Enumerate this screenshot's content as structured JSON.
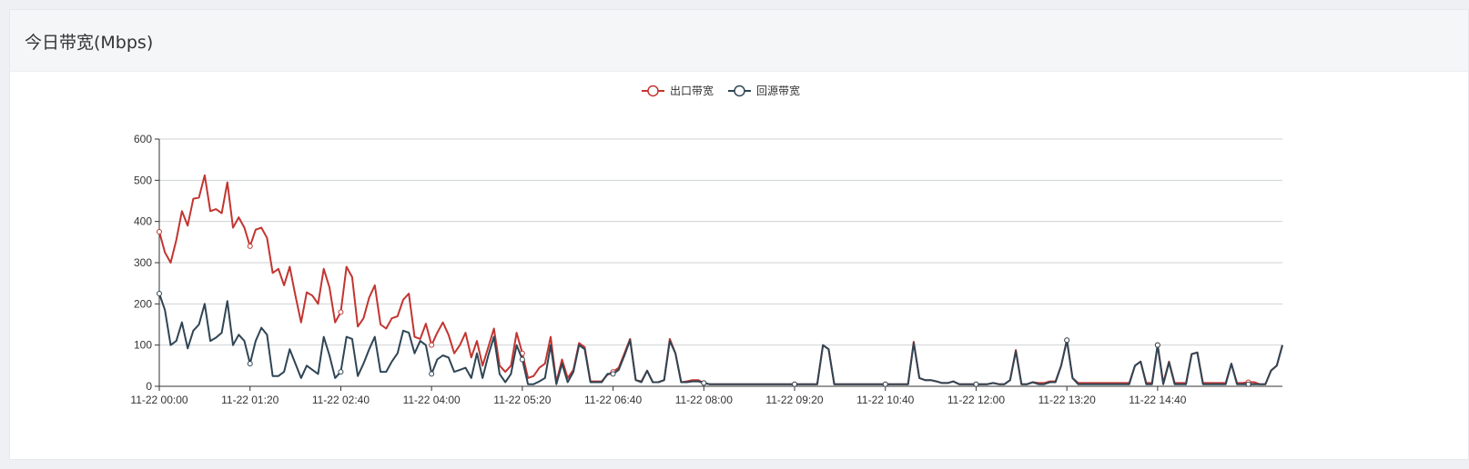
{
  "header": {
    "title": "今日带宽(Mbps)"
  },
  "chart_data": {
    "type": "line",
    "title": "",
    "xlabel": "",
    "ylabel": "",
    "ylim": [
      0,
      600
    ],
    "yticks": [
      0,
      100,
      200,
      300,
      400,
      500,
      600
    ],
    "grid": true,
    "legend_position": "top-center",
    "x_tick_labels": [
      "11-22 00:00",
      "11-22 01:20",
      "11-22 02:40",
      "11-22 04:00",
      "11-22 05:20",
      "11-22 06:40",
      "11-22 08:00",
      "11-22 09:20",
      "11-22 10:40",
      "11-22 12:00",
      "11-22 13:20",
      "11-22 14:40"
    ],
    "x_interval_minutes": 5,
    "series": [
      {
        "name": "出口带宽",
        "color": "#c23531",
        "values": [
          375,
          325,
          300,
          355,
          425,
          390,
          455,
          458,
          512,
          425,
          430,
          420,
          495,
          385,
          410,
          385,
          340,
          380,
          385,
          360,
          275,
          285,
          245,
          290,
          220,
          155,
          228,
          220,
          200,
          285,
          240,
          155,
          180,
          290,
          265,
          145,
          165,
          215,
          245,
          150,
          140,
          165,
          170,
          210,
          225,
          120,
          115,
          152,
          100,
          130,
          155,
          125,
          80,
          100,
          130,
          70,
          110,
          50,
          95,
          140,
          50,
          35,
          50,
          130,
          80,
          20,
          25,
          45,
          55,
          120,
          10,
          65,
          20,
          40,
          105,
          95,
          12,
          12,
          12,
          28,
          35,
          45,
          80,
          115,
          15,
          12,
          38,
          10,
          10,
          15,
          115,
          80,
          10,
          12,
          15,
          15,
          8,
          5,
          5,
          5,
          5,
          5,
          5,
          5,
          5,
          5,
          5,
          5,
          5,
          5,
          5,
          5,
          5,
          5,
          5,
          5,
          5,
          100,
          90,
          5,
          5,
          5,
          5,
          5,
          5,
          5,
          5,
          5,
          5,
          5,
          5,
          5,
          5,
          108,
          20,
          15,
          15,
          12,
          8,
          8,
          12,
          5,
          5,
          5,
          5,
          5,
          5,
          8,
          5,
          5,
          15,
          88,
          5,
          5,
          10,
          8,
          8,
          12,
          12,
          50,
          112,
          20,
          8,
          8,
          8,
          8,
          8,
          8,
          8,
          8,
          8,
          8,
          50,
          60,
          8,
          8,
          100,
          8,
          60,
          8,
          8,
          8,
          78,
          82,
          8,
          8,
          8,
          8,
          8,
          55,
          8,
          8,
          10,
          10,
          5,
          5,
          38,
          50,
          100
        ]
      },
      {
        "name": "回源带宽",
        "color": "#2f4554",
        "values": [
          225,
          185,
          100,
          110,
          155,
          92,
          135,
          150,
          200,
          110,
          118,
          130,
          207,
          100,
          125,
          110,
          55,
          110,
          142,
          125,
          25,
          25,
          35,
          90,
          55,
          20,
          50,
          40,
          30,
          120,
          75,
          20,
          35,
          120,
          115,
          25,
          55,
          90,
          120,
          35,
          35,
          60,
          80,
          135,
          130,
          80,
          110,
          100,
          30,
          65,
          75,
          70,
          35,
          40,
          45,
          20,
          80,
          20,
          75,
          120,
          30,
          10,
          30,
          100,
          65,
          5,
          5,
          12,
          20,
          100,
          5,
          55,
          10,
          35,
          100,
          90,
          10,
          10,
          10,
          30,
          30,
          40,
          75,
          112,
          15,
          10,
          38,
          10,
          10,
          15,
          110,
          80,
          10,
          10,
          12,
          12,
          8,
          5,
          5,
          5,
          5,
          5,
          5,
          5,
          5,
          5,
          5,
          5,
          5,
          5,
          5,
          5,
          5,
          5,
          5,
          5,
          5,
          100,
          90,
          5,
          5,
          5,
          5,
          5,
          5,
          5,
          5,
          5,
          5,
          5,
          5,
          5,
          5,
          105,
          20,
          15,
          15,
          12,
          8,
          8,
          12,
          5,
          5,
          5,
          5,
          5,
          5,
          8,
          5,
          5,
          15,
          85,
          5,
          5,
          10,
          5,
          5,
          10,
          10,
          50,
          112,
          20,
          5,
          5,
          5,
          5,
          5,
          5,
          5,
          5,
          5,
          5,
          50,
          60,
          5,
          5,
          100,
          5,
          58,
          5,
          5,
          5,
          78,
          82,
          5,
          5,
          5,
          5,
          5,
          55,
          5,
          5,
          5,
          5,
          5,
          5,
          38,
          50,
          100
        ]
      }
    ]
  }
}
